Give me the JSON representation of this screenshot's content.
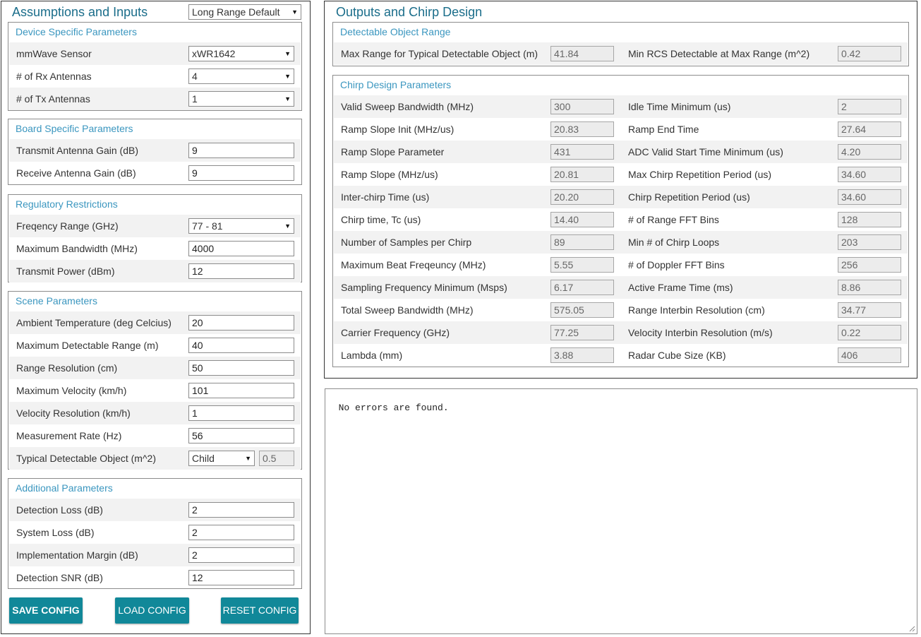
{
  "left": {
    "title": "Assumptions and Inputs",
    "profile_select": "Long Range Default",
    "device": {
      "title": "Device Specific Parameters",
      "sensor_label": "mmWave Sensor",
      "sensor_value": "xWR1642",
      "rx_label": "# of Rx Antennas",
      "rx_value": "4",
      "tx_label": "# of Tx Antennas",
      "tx_value": "1"
    },
    "board": {
      "title": "Board Specific Parameters",
      "tx_gain_label": "Transmit Antenna Gain (dB)",
      "tx_gain_value": "9",
      "rx_gain_label": "Receive Antenna Gain (dB)",
      "rx_gain_value": "9"
    },
    "regulatory": {
      "title": "Regulatory Restrictions",
      "freq_label": "Freqency Range (GHz)",
      "freq_value": "77 - 81",
      "bw_label": "Maximum Bandwidth (MHz)",
      "bw_value": "4000",
      "power_label": "Transmit Power (dBm)",
      "power_value": "12"
    },
    "scene": {
      "title": "Scene Parameters",
      "temp_label": "Ambient Temperature (deg Celcius)",
      "temp_value": "20",
      "range_label": "Maximum Detectable Range (m)",
      "range_value": "40",
      "res_label": "Range Resolution (cm)",
      "res_value": "50",
      "vel_label": "Maximum Velocity (km/h)",
      "vel_value": "101",
      "velres_label": "Velocity Resolution (km/h)",
      "velres_value": "1",
      "rate_label": "Measurement Rate (Hz)",
      "rate_value": "56",
      "object_label": "Typical Detectable Object (m^2)",
      "object_value": "Child",
      "object_rcs": "0.5"
    },
    "additional": {
      "title": "Additional Parameters",
      "det_loss_label": "Detection Loss (dB)",
      "det_loss_value": "2",
      "sys_loss_label": "System Loss (dB)",
      "sys_loss_value": "2",
      "impl_label": "Implementation Margin (dB)",
      "impl_value": "2",
      "snr_label": "Detection SNR (dB)",
      "snr_value": "12"
    },
    "buttons": {
      "save": "SAVE CONFIG",
      "load": "LOAD CONFIG",
      "reset": "RESET CONFIG"
    }
  },
  "right": {
    "title": "Outputs and Chirp Design",
    "detectable": {
      "title": "Detectable Object Range",
      "max_range_label": "Max Range for Typical Detectable Object (m)",
      "max_range_value": "41.84",
      "min_rcs_label": "Min RCS Detectable at Max Range (m^2)",
      "min_rcs_value": "0.42"
    },
    "chirp": {
      "title": "Chirp Design Parameters",
      "rows": [
        {
          "l1": "Valid Sweep Bandwidth (MHz)",
          "v1": "300",
          "l2": "Idle Time Minimum (us)",
          "v2": "2"
        },
        {
          "l1": "Ramp Slope Init (MHz/us)",
          "v1": "20.83",
          "l2": "Ramp End Time",
          "v2": "27.64"
        },
        {
          "l1": "Ramp Slope Parameter",
          "v1": "431",
          "l2": "ADC Valid Start Time Minimum (us)",
          "v2": "4.20"
        },
        {
          "l1": "Ramp Slope (MHz/us)",
          "v1": "20.81",
          "l2": "Max Chirp Repetition Period (us)",
          "v2": "34.60"
        },
        {
          "l1": "Inter-chirp Time (us)",
          "v1": "20.20",
          "l2": "Chirp Repetition Period (us)",
          "v2": "34.60"
        },
        {
          "l1": "Chirp time, Tc (us)",
          "v1": "14.40",
          "l2": "# of Range FFT Bins",
          "v2": "128"
        },
        {
          "l1": "Number of Samples per Chirp",
          "v1": "89",
          "l2": "Min # of Chirp Loops",
          "v2": "203"
        },
        {
          "l1": "Maximum Beat Freqeuncy (MHz)",
          "v1": "5.55",
          "l2": "# of Doppler FFT Bins",
          "v2": "256"
        },
        {
          "l1": "Sampling Frequency Minimum (Msps)",
          "v1": "6.17",
          "l2": "Active Frame Time (ms)",
          "v2": "8.86"
        },
        {
          "l1": "Total Sweep Bandwidth (MHz)",
          "v1": "575.05",
          "l2": "Range Interbin Resolution (cm)",
          "v2": "34.77"
        },
        {
          "l1": "Carrier Frequency (GHz)",
          "v1": "77.25",
          "l2": "Velocity Interbin Resolution (m/s)",
          "v2": "0.22"
        },
        {
          "l1": "Lambda (mm)",
          "v1": "3.88",
          "l2": "Radar Cube Size (KB)",
          "v2": "406"
        }
      ]
    }
  },
  "console": {
    "text": "No errors are found."
  },
  "icons": {
    "dropdown": "caret-down-icon",
    "resize": "resize-grip-icon"
  },
  "colors": {
    "title": "#1a6d8a",
    "group_title": "#3a96bf",
    "button": "#118899",
    "row_shade": "#f2f2f2"
  }
}
